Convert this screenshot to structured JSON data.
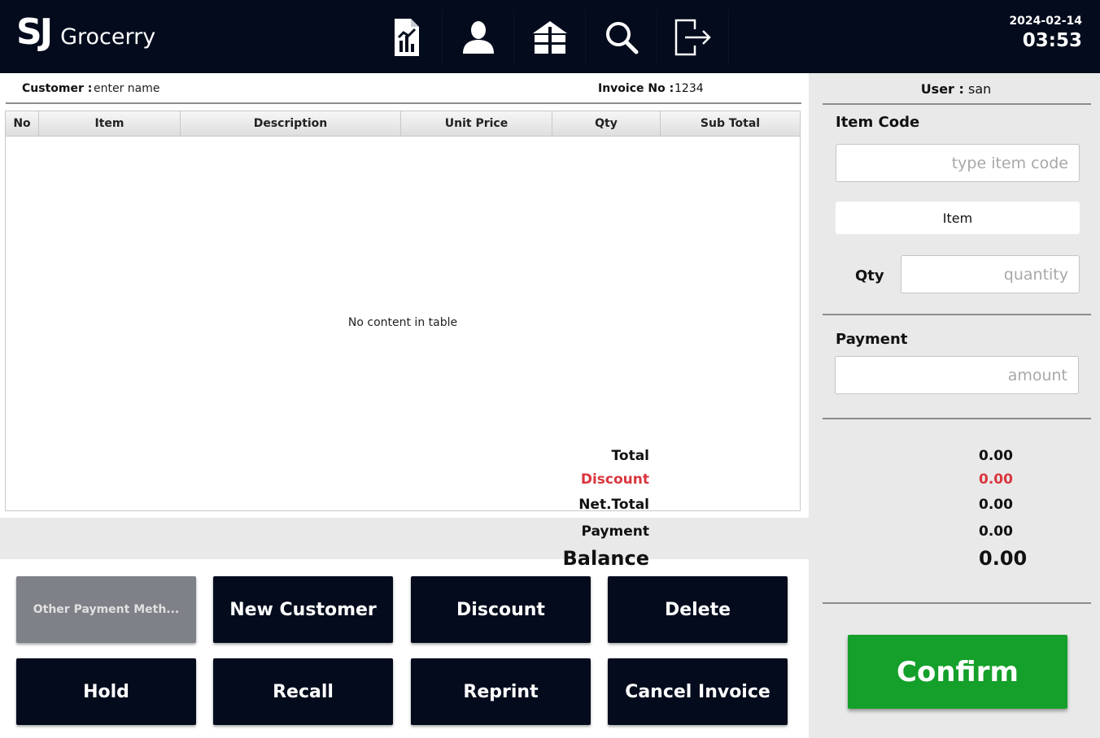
{
  "header": {
    "logo_mark": "SJ",
    "logo_name": "Grocerry",
    "date": "2024-02-14",
    "time": "03:53",
    "nav_icons": [
      "report-icon",
      "user-icon",
      "store-icon",
      "search-icon",
      "logout-icon"
    ],
    "background_color": "#030b1c"
  },
  "invoice": {
    "customer_label": "Customer :",
    "customer_placeholder": "enter name",
    "invoice_label": "Invoice No :",
    "invoice_number": "1234"
  },
  "table": {
    "columns": [
      "No",
      "Item",
      "Description",
      "Unit Price",
      "Qty",
      "Sub Total"
    ],
    "rows": [],
    "empty_message": "No content in table"
  },
  "actions": {
    "other_payment": "Other Payment Meth...",
    "new_customer": "New Customer",
    "discount": "Discount",
    "delete": "Delete",
    "hold": "Hold",
    "recall": "Recall",
    "reprint": "Reprint",
    "cancel_invoice": "Cancel Invoice"
  },
  "sidebar": {
    "user_label": "User :",
    "user_name": "san",
    "item_code_label": "Item Code",
    "item_code_placeholder": "type item code",
    "item_display": "Item",
    "qty_label": "Qty",
    "qty_placeholder": "quantity",
    "payment_label": "Payment",
    "payment_placeholder": "amount"
  },
  "totals": {
    "total_label": "Total",
    "total_value": "0.00",
    "discount_label": "Discount",
    "discount_value": "0.00",
    "net_total_label": "Net.Total",
    "net_total_value": "0.00",
    "payment_label": "Payment",
    "payment_value": "0.00",
    "balance_label": "Balance",
    "balance_value": "0.00",
    "discount_color": "#d9363e"
  },
  "confirm": {
    "label": "Confirm",
    "color": "#14a02a"
  }
}
